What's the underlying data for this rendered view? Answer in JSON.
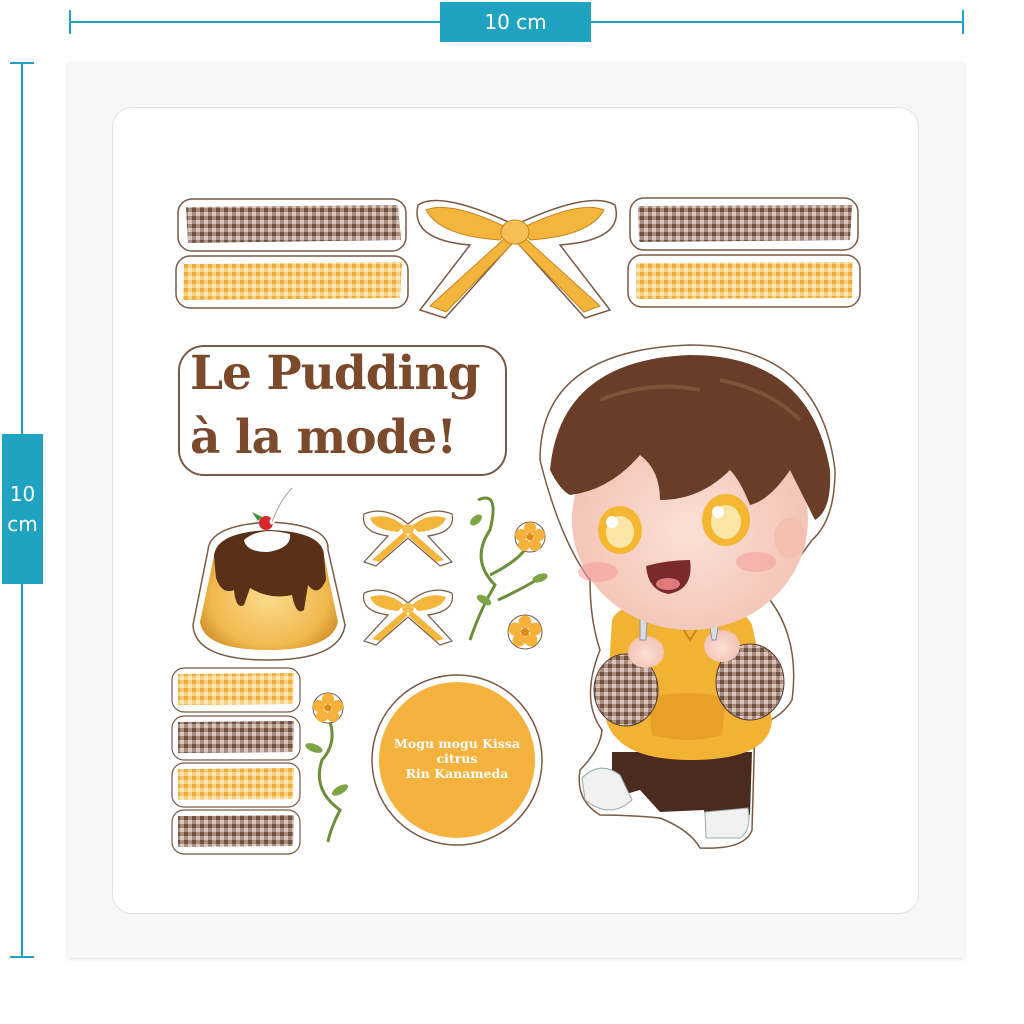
{
  "dimensions": {
    "width_label": "10 cm",
    "height_value": "10",
    "height_unit": "cm"
  },
  "title": {
    "line1": "Le Pudding",
    "line2": "à la mode!"
  },
  "credit": {
    "line1": "Mogu mogu Kissa",
    "line2": "citrus",
    "line3": "Rin Kanameda"
  },
  "colors": {
    "accent": "#1fa3c0",
    "title_brown": "#7b4a2d",
    "yellow": "#f6b23a",
    "badge_orange": "#f6b23e",
    "gingham_brown": "#8a6a58",
    "gingham_yellow": "#f5c86a"
  }
}
